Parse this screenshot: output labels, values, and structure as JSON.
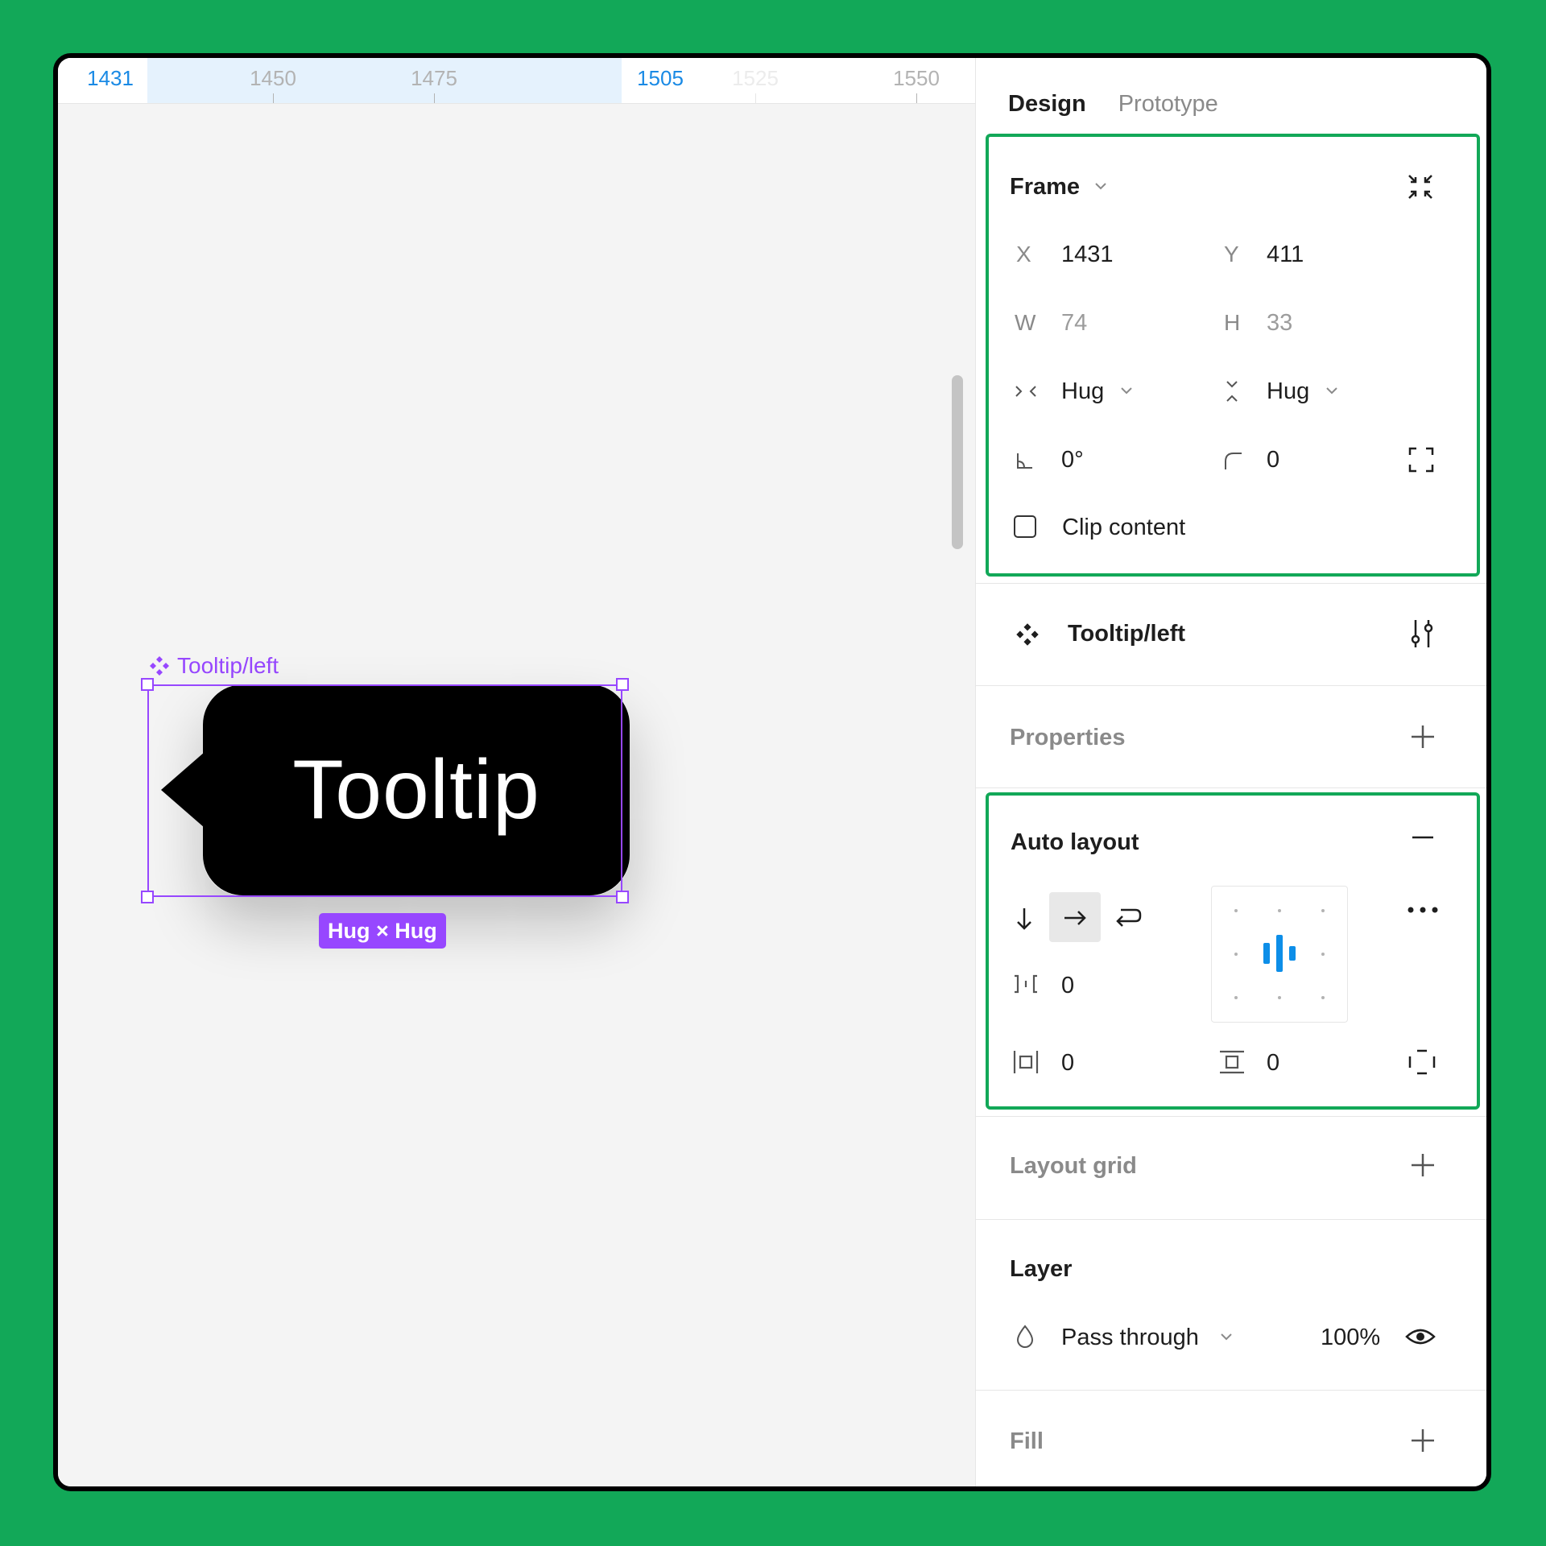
{
  "ruler": {
    "labels": [
      "1431",
      "1450",
      "1475",
      "1505",
      "1525",
      "1550"
    ]
  },
  "canvas": {
    "frame_label": "Tooltip/left",
    "tooltip_text": "Tooltip",
    "size_badge": "Hug × Hug",
    "accent": "#9747ff"
  },
  "panel": {
    "tabs": [
      "Design",
      "Prototype"
    ],
    "frame": {
      "title": "Frame",
      "x_label": "X",
      "x_value": "1431",
      "y_label": "Y",
      "y_value": "411",
      "w_label": "W",
      "w_value": "74",
      "h_label": "H",
      "h_value": "33",
      "width_mode": "Hug",
      "height_mode": "Hug",
      "rotation": "0°",
      "radius": "0",
      "clip_label": "Clip content"
    },
    "component": {
      "name": "Tooltip/left"
    },
    "properties": {
      "title": "Properties"
    },
    "auto_layout": {
      "title": "Auto layout",
      "gap": "0",
      "padding_h": "0",
      "padding_v": "0"
    },
    "layout_grid": {
      "title": "Layout grid"
    },
    "layer": {
      "title": "Layer",
      "blend": "Pass through",
      "opacity": "100%"
    },
    "fill": {
      "title": "Fill"
    },
    "highlight_color": "#12a858"
  }
}
